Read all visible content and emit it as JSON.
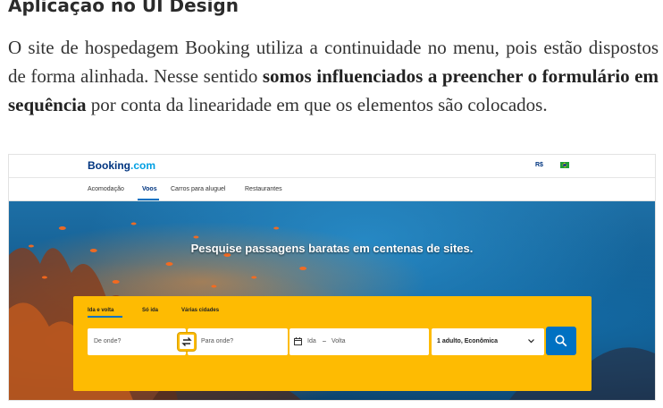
{
  "article": {
    "heading": "Aplicação no UI Design",
    "paragraph": {
      "part1": "O site de hospedagem Booking utiliza a continuidade no menu, pois estão dispostos de forma alinhada. Nesse sentido ",
      "bold": "somos influenciados a preencher o formulário em sequência",
      "part2": " por conta da linearidade em que os elementos são colocados."
    }
  },
  "booking": {
    "logo_main": "Booking",
    "logo_suffix": ".com",
    "currency": "R$",
    "nav": [
      "Acomodação",
      "Voos",
      "Carros para aluguel",
      "Restaurantes"
    ],
    "hero_title": "Pesquise passagens baratas em centenas de sites.",
    "tabs": [
      "Ida e volta",
      "Só ida",
      "Várias cidades"
    ],
    "origin_placeholder": "De onde?",
    "destination_placeholder": "Para onde?",
    "date_from": "Ida",
    "date_separator": "–",
    "date_to": "Volta",
    "passengers": "1 adulto, Econômica",
    "colors": {
      "brand": "#003580",
      "accent": "#0071c2",
      "search_box": "#febb02"
    }
  }
}
